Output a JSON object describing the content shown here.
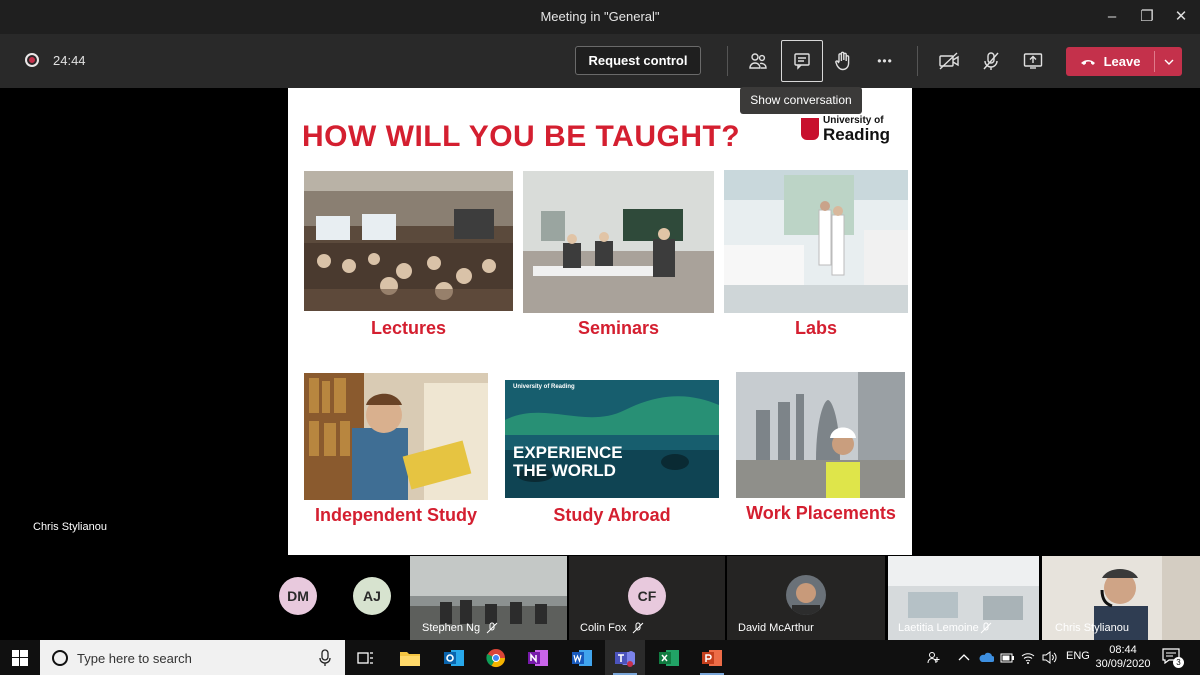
{
  "window": {
    "title": "Meeting in \"General\"",
    "minimize_glyph": "–",
    "restore_glyph": "❐",
    "close_glyph": "✕"
  },
  "toolbar": {
    "timer": "24:44",
    "request_control_label": "Request control",
    "leave_label": "Leave",
    "more_glyph": "•••",
    "icons": [
      "participants-icon",
      "chat-icon",
      "raise-hand-icon",
      "more-options-icon",
      "camera-off-icon",
      "mic-off-icon",
      "share-tray-icon"
    ],
    "leave_color": "#c4314b"
  },
  "tooltip": {
    "text": "Show conversation"
  },
  "slide": {
    "title": "HOW WILL YOU BE TAUGHT?",
    "logo_line1": "University of",
    "logo_line2": "Reading",
    "captions": {
      "lectures": "Lectures",
      "seminars": "Seminars",
      "labs": "Labs",
      "independent_study": "Independent Study",
      "study_abroad": "Study Abroad",
      "work_placements": "Work Placements"
    },
    "experience_line1": "EXPERIENCE",
    "experience_line2": "THE WORLD",
    "experience_small": "University of Reading",
    "accent_color": "#d41f30"
  },
  "stage": {
    "presenter_name": "Chris Stylianou"
  },
  "participants": [
    {
      "initials": "DM",
      "name": ""
    },
    {
      "initials": "AJ",
      "name": ""
    },
    {
      "initials": "",
      "name": "Stephen Ng"
    },
    {
      "initials": "CF",
      "name": "Colin Fox"
    },
    {
      "initials": "",
      "name": "David McArthur"
    },
    {
      "initials": "",
      "name": "Laetitia Lemoine"
    },
    {
      "initials": "",
      "name": "Chris Stylianou"
    }
  ],
  "taskbar": {
    "search_placeholder": "Type here to search",
    "apps": [
      "task-view-icon",
      "file-explorer-icon",
      "outlook-icon",
      "chrome-icon",
      "onenote-icon",
      "word-icon",
      "teams-icon",
      "excel-icon",
      "powerpoint-icon"
    ],
    "language": "ENG",
    "time": "08:44",
    "date": "30/09/2020",
    "notification_count": "3"
  }
}
